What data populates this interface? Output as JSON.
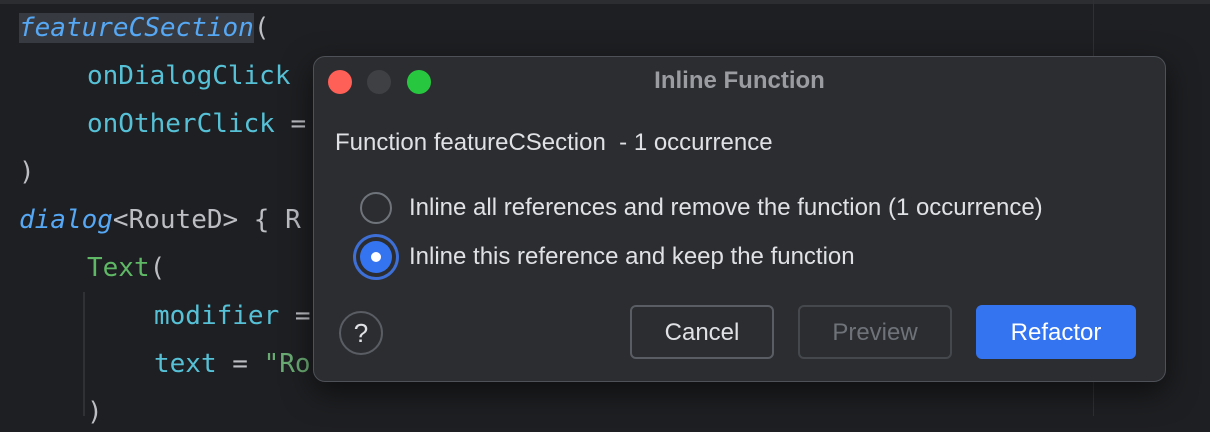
{
  "editor": {
    "line1": {
      "fn": "featureCSection",
      "rest": "("
    },
    "line2": {
      "param": "onDialogClick"
    },
    "line3": {
      "param": "onOtherClick",
      "rest": " ="
    },
    "line4": {
      "text": ")"
    },
    "line5": {
      "fn": "dialog",
      "type": "<RouteD>",
      "rest": " { R"
    },
    "line6": {
      "comp": "Text",
      "rest": "("
    },
    "line7": {
      "param": "modifier",
      "rest": " ="
    },
    "line8": {
      "param": "text",
      "op": " = ",
      "str": "\"Ro"
    },
    "line9": {
      "text": ")"
    }
  },
  "dialog": {
    "title": "Inline Function",
    "description": "Function featureCSection  - 1 occurrence",
    "options": [
      {
        "label": "Inline all references and remove the function (1 occurrence)",
        "selected": false
      },
      {
        "label": "Inline this reference and keep the function",
        "selected": true
      }
    ],
    "help_label": "?",
    "cancel_label": "Cancel",
    "preview_label": "Preview",
    "refactor_label": "Refactor"
  },
  "colors": {
    "accent": "#3574f0",
    "close": "#fe5f57",
    "maximize": "#27c840"
  }
}
